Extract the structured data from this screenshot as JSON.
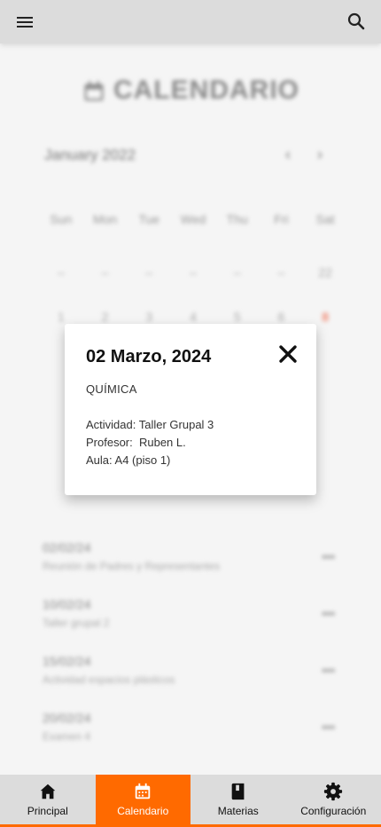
{
  "colors": {
    "accent": "#ff6a00",
    "weekend_red": "#ef5a3a",
    "topbar": "#dcdcdc"
  },
  "topbar": {
    "menu_icon": "menu-icon",
    "search_icon": "search-icon"
  },
  "calendar": {
    "title": "CALENDARIO",
    "title_icon": "calendar-icon",
    "month": "January 2022",
    "prev": "‹",
    "next": "›",
    "weekdays": [
      "Sun",
      "Mon",
      "Tue",
      "Wed",
      "Thu",
      "Fri",
      "Sat"
    ],
    "rows": [
      [
        "–",
        "–",
        "–",
        "–",
        "–",
        "–",
        "22"
      ],
      [
        "1",
        "2",
        "3",
        "4",
        "5",
        "6",
        "8"
      ]
    ]
  },
  "events": [
    {
      "date": "02/02/24",
      "desc": "Reunión de Padres y Representantes",
      "more": "•••"
    },
    {
      "date": "10/02/24",
      "desc": "Taller grupal 2",
      "more": "•••"
    },
    {
      "date": "15/02/24",
      "desc": "Actividad espacios plásticos",
      "more": "•••"
    },
    {
      "date": "20/02/24",
      "desc": "Examen 4",
      "more": "•••"
    }
  ],
  "modal": {
    "date": "02 Marzo, 2024",
    "subject": "QUÍMICA",
    "activity": "Actividad: Taller Grupal 3",
    "professor": "Profesor:  Ruben L.",
    "room": "Aula: A4 (piso 1)",
    "close_icon": "close-icon"
  },
  "nav": [
    {
      "label": "Principal",
      "icon": "home-icon"
    },
    {
      "label": "Calendario",
      "icon": "calendar-icon",
      "active": true
    },
    {
      "label": "Materias",
      "icon": "book-icon"
    },
    {
      "label": "Configuración",
      "icon": "gear-icon"
    }
  ]
}
